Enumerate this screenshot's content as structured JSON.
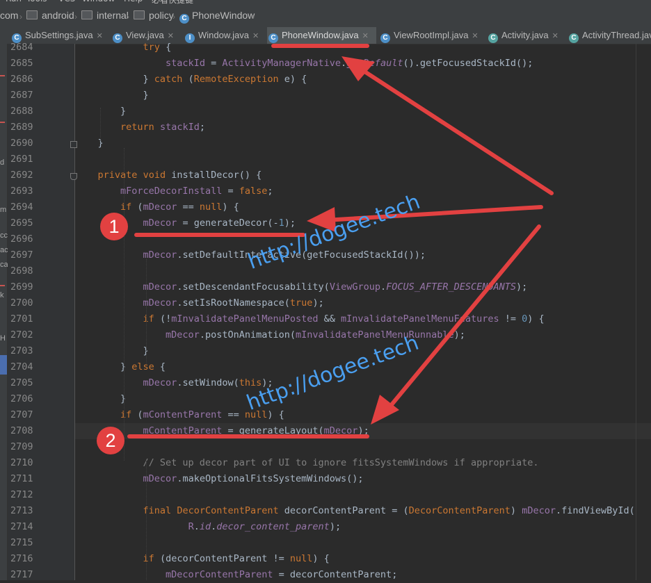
{
  "menu": [
    "Run",
    "Tools",
    "VCS",
    "Window",
    "Help",
    "必看快捷键"
  ],
  "breadcrumb": [
    "com",
    "android",
    "internal",
    "policy",
    "PhoneWindow"
  ],
  "tabs": [
    {
      "label": "SubSettings.java",
      "active": false
    },
    {
      "label": "View.java",
      "active": false
    },
    {
      "label": "Window.java",
      "active": false
    },
    {
      "label": "PhoneWindow.java",
      "active": true
    },
    {
      "label": "ViewRootImpl.java",
      "active": false
    },
    {
      "label": "Activity.java",
      "active": false
    },
    {
      "label": "ActivityThread.java",
      "active": false
    }
  ],
  "left_strip_labels": [
    "d",
    "m",
    "cc",
    "ac",
    "ca",
    "k",
    "H"
  ],
  "gutter": {
    "first_line": 2684,
    "last_line": 2717,
    "caret_line": 2708
  },
  "code_lines": [
    "            try {",
    "                stackId = ActivityManagerNative.getDefault().getFocusedStackId();",
    "            } catch (RemoteException e) {",
    "            }",
    "        }",
    "        return stackId;",
    "    }",
    "",
    "    private void installDecor() {",
    "        mForceDecorInstall = false;",
    "        if (mDecor == null) {",
    "            mDecor = generateDecor(-1);",
    "",
    "            mDecor.setDefaultInteractive(getFocusedStackId());",
    "",
    "            mDecor.setDescendantFocusability(ViewGroup.FOCUS_AFTER_DESCENDANTS);",
    "            mDecor.setIsRootNamespace(true);",
    "            if (!mInvalidatePanelMenuPosted && mInvalidatePanelMenuFeatures != 0) {",
    "                mDecor.postOnAnimation(mInvalidatePanelMenuRunnable);",
    "            }",
    "        } else {",
    "            mDecor.setWindow(this);",
    "        }",
    "        if (mContentParent == null) {",
    "            mContentParent = generateLayout(mDecor);",
    "",
    "            // Set up decor part of UI to ignore fitsSystemWindows if appropriate.",
    "            mDecor.makeOptionalFitsSystemWindows();",
    "",
    "            final DecorContentParent decorContentParent = (DecorContentParent) mDecor.findViewById(",
    "                    R.id.decor_content_parent);",
    "",
    "            if (decorContentParent != null) {",
    "                mDecorContentParent = decorContentParent;"
  ],
  "annotations": {
    "badge_1": "1",
    "badge_2": "2",
    "watermark": "http://dogee.tech"
  },
  "colors": {
    "editor_bg": "#2b2b2b",
    "keyword": "#cc7832",
    "field": "#9876aa",
    "string": "#6a8759",
    "number": "#6897bb",
    "comment": "#808080",
    "annotation": "#e24141",
    "watermark": "#4a9ff0"
  }
}
